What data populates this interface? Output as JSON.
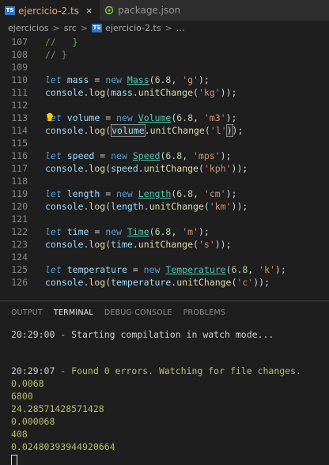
{
  "tabs": [
    {
      "label": "ejercicio-2.ts",
      "badge": "TS",
      "close": "×",
      "active": true
    },
    {
      "label": "package.json",
      "active": false
    }
  ],
  "breadcrumb": {
    "parts": [
      "ejercicios",
      "src",
      "ejercicio-2.ts",
      "…"
    ],
    "separator": ">",
    "badge": "TS"
  },
  "code_lines": [
    {
      "n": "107",
      "text": "//   }"
    },
    {
      "n": "108",
      "text": "// }"
    },
    {
      "n": "109",
      "text": ""
    },
    {
      "n": "110",
      "kw": "let",
      "var": "mass",
      "cls": "Mass",
      "num": "6.8",
      "str": "'g'"
    },
    {
      "n": "111",
      "obj": "mass",
      "arg": "'kg'"
    },
    {
      "n": "112",
      "text": ""
    },
    {
      "n": "113",
      "kw": "let",
      "var": "volume",
      "cls": "Volume",
      "num": "6.8",
      "str": "'m3'"
    },
    {
      "n": "114",
      "obj": "volume",
      "arg": "'l'"
    },
    {
      "n": "115",
      "text": ""
    },
    {
      "n": "116",
      "kw": "let",
      "var": "speed",
      "cls": "Speed",
      "num": "6.8",
      "str": "'mps'"
    },
    {
      "n": "117",
      "obj": "speed",
      "arg": "'kph'"
    },
    {
      "n": "118",
      "text": ""
    },
    {
      "n": "119",
      "kw": "let",
      "var": "length",
      "cls": "Length",
      "num": "6.8",
      "str": "'cm'"
    },
    {
      "n": "120",
      "obj": "length",
      "arg": "'km'"
    },
    {
      "n": "121",
      "text": ""
    },
    {
      "n": "122",
      "kw": "let",
      "var": "time",
      "cls": "Time",
      "num": "6.8",
      "str": "'m'"
    },
    {
      "n": "123",
      "obj": "time",
      "arg": "'s'"
    },
    {
      "n": "124",
      "text": ""
    },
    {
      "n": "125",
      "kw": "let",
      "var": "temperature",
      "cls": "Temperature",
      "num": "6.8",
      "str": "'k'"
    },
    {
      "n": "126",
      "obj": "temperature",
      "arg": "'c'"
    }
  ],
  "code_tokens": {
    "assign": " = ",
    "new": "new",
    "console": "console",
    "log": "log",
    "method": "unitChange",
    "semi": ";"
  },
  "panel": {
    "tabs": [
      "OUTPUT",
      "TERMINAL",
      "DEBUG CONSOLE",
      "PROBLEMS"
    ],
    "active_tab": "TERMINAL"
  },
  "terminal": {
    "line1": "20:29:00 - Starting compilation in watch mode...",
    "line2_time": "20:29:07",
    "line2_msg": " - Found 0 errors. Watching for file changes.",
    "outputs": [
      "0.0068",
      "6800",
      "24.28571428571428",
      "0.000068",
      "408",
      "0.02480393944920664"
    ]
  },
  "colors": {
    "background": "#1e1e1e",
    "keyword": "#569cd6",
    "class": "#4ec9b0",
    "string": "#ce9178",
    "number": "#b5cea8",
    "comment": "#6a9955",
    "ts_blue": "#3178c6"
  }
}
